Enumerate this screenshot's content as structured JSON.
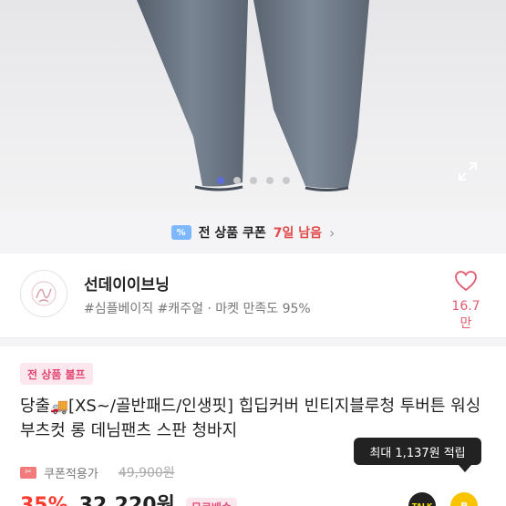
{
  "gallery": {
    "image_alt": "product-photo-jeans",
    "dot_count": 5,
    "active_dot": 0,
    "expand_icon": "expand-icon"
  },
  "coupon_banner": {
    "icon": "coupon-ticket-icon",
    "ticket_symbol": "%",
    "text": "전 상품 쿠폰",
    "days_left": "7일 남음",
    "chevron": "›"
  },
  "shop": {
    "logo_icon": "shop-logo",
    "name": "선데이이브닝",
    "tags": "#심플베이직 #캐주얼 · 마켓 만족도 95%",
    "favorite_icon": "heart-icon",
    "favorite_count": "16.7만"
  },
  "product": {
    "badge": "전 상품 불프",
    "title_prefix": "당출",
    "title_main": "[XS~/골반패드/인생핏] 힙딥커버 빈티지블루청 투버튼 워싱 부츠컷 롱 데님팬츠 스판 청바지",
    "coupon_label": "쿠폰적용가",
    "coupon_symbol": "✂",
    "original_price": "49,900원",
    "discount": "35%",
    "price": "32,220원",
    "shipping_badge": "무료배송"
  },
  "tooltip": {
    "text": "최대 1,137원 적립"
  },
  "actions": {
    "talk_label": "TALK",
    "point_label": "P"
  },
  "colors": {
    "accent_red": "#ff3b30",
    "pink": "#e2456f",
    "active_dot": "#5f6bd8"
  }
}
